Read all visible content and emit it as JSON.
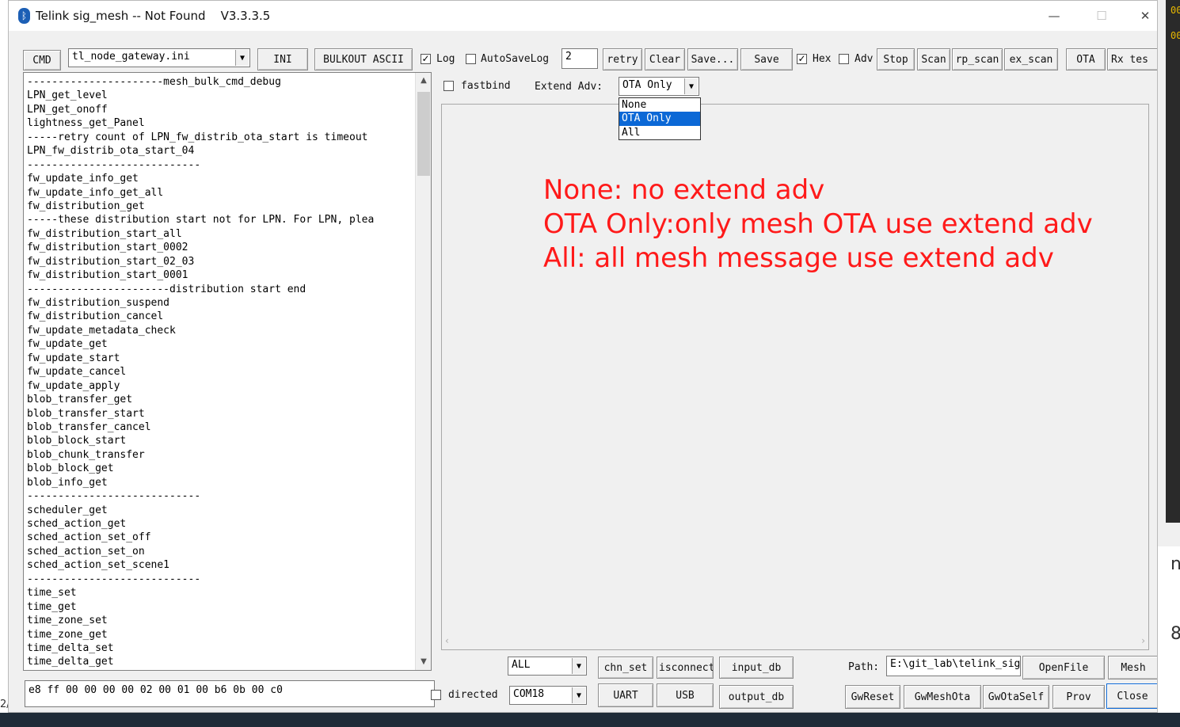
{
  "window": {
    "title": "Telink sig_mesh -- Not Found    V3.3.3.5",
    "min_glyph": "—",
    "max_glyph": "☐",
    "close_glyph": "✕"
  },
  "toolbar": {
    "cmd": "CMD",
    "ini_file": "tl_node_gateway.ini",
    "ini": "INI",
    "bulkout": "BULKOUT ASCII",
    "log_label": "Log",
    "log_checked": "✓",
    "autosave_label": "AutoSaveLog",
    "retry_value": "2",
    "retry": "retry",
    "clear": "Clear",
    "save_as": "Save...",
    "save": "Save",
    "hex_label": "Hex",
    "hex_checked": "✓",
    "adv_label": "Adv",
    "stop": "Stop",
    "scan": "Scan",
    "rp_scan": "rp_scan",
    "ex_scan": "ex_scan",
    "ota": "OTA",
    "rx_test": "Rx tes"
  },
  "options": {
    "fastbind": "fastbind",
    "extend_adv_label": "Extend Adv:",
    "extend_adv_value": "OTA Only",
    "extend_adv_options": [
      "None",
      "OTA Only",
      "All"
    ]
  },
  "command_list": [
    "----------------------mesh_bulk_cmd_debug",
    "LPN_get_level",
    "LPN_get_onoff",
    "lightness_get_Panel",
    "-----retry count of LPN_fw_distrib_ota_start is timeout",
    "LPN_fw_distrib_ota_start_04",
    "----------------------------",
    "fw_update_info_get",
    "fw_update_info_get_all",
    "fw_distribution_get",
    "-----these distribution start not for LPN. For LPN, plea",
    "fw_distribution_start_all",
    "fw_distribution_start_0002",
    "fw_distribution_start_02_03",
    "fw_distribution_start_0001",
    "-----------------------distribution start end",
    "fw_distribution_suspend",
    "fw_distribution_cancel",
    "fw_update_metadata_check",
    "fw_update_get",
    "fw_update_start",
    "fw_update_cancel",
    "fw_update_apply",
    "blob_transfer_get",
    "blob_transfer_start",
    "blob_transfer_cancel",
    "blob_block_start",
    "blob_chunk_transfer",
    "blob_block_get",
    "blob_info_get",
    "----------------------------",
    "scheduler_get",
    "sched_action_get",
    "sched_action_set_off",
    "sched_action_set_on",
    "sched_action_set_scene1",
    "----------------------------",
    "time_set",
    "time_get",
    "time_zone_set",
    "time_zone_get",
    "time_delta_set",
    "time_delta_get"
  ],
  "annotation": [
    "None: no extend adv",
    "OTA Only:only mesh OTA use extend adv",
    "All: all mesh message use extend adv"
  ],
  "bottom": {
    "hex_input": "e8 ff 00 00 00 00 02 00 01 00 b6 0b 00 c0",
    "directed": "directed",
    "dest_value": "ALL",
    "port_value": "COM18",
    "chn_set": "chn_set",
    "isconnect": "isconnect",
    "uart": "UART",
    "usb": "USB",
    "input_db": "input_db",
    "output_db": "output_db",
    "path_label": "Path:",
    "path_value": "E:\\git_lab\\telink_sig_mesh",
    "open_file": "OpenFile",
    "mesh": "Mesh",
    "gw_reset": "GwReset",
    "gw_mesh_ota": "GwMeshOta",
    "gw_ota_self": "GwOtaSelf",
    "prov": "Prov",
    "close": "Close"
  },
  "background": {
    "num_top": "00",
    "num_second": "00",
    "glyph_mid": "n",
    "glyph_low": "8",
    "left_edge": "2/"
  },
  "colors": {
    "annotation": "#ff1a1a",
    "selection": "#0b68d6"
  }
}
